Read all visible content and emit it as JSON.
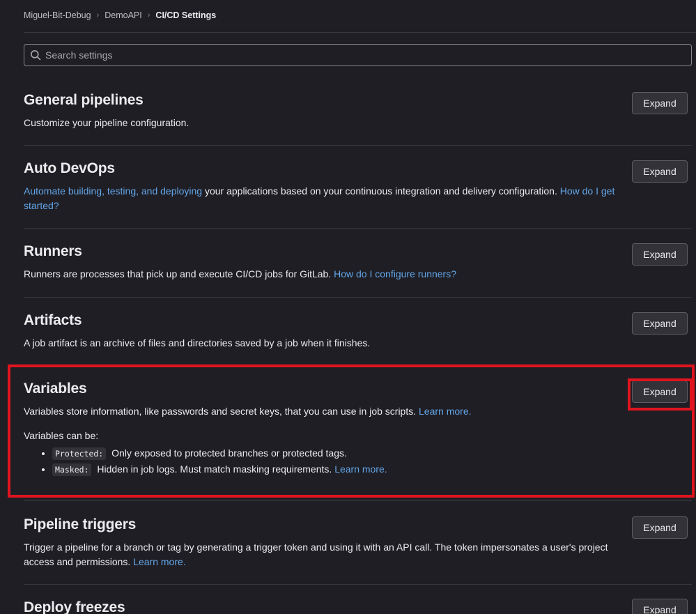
{
  "breadcrumb": {
    "items": [
      "Miguel-Bit-Debug",
      "DemoAPI",
      "CI/CD Settings"
    ],
    "separator": "›"
  },
  "search": {
    "placeholder": "Search settings",
    "value": ""
  },
  "expand_label": "Expand",
  "sections": {
    "general": {
      "title": "General pipelines",
      "desc": "Customize your pipeline configuration."
    },
    "autodevops": {
      "title": "Auto DevOps",
      "link1": "Automate building, testing, and deploying",
      "text": " your applications based on your continuous integration and delivery configuration. ",
      "link2": "How do I get started?"
    },
    "runners": {
      "title": "Runners",
      "text": "Runners are processes that pick up and execute CI/CD jobs for GitLab. ",
      "link": "How do I configure runners?"
    },
    "artifacts": {
      "title": "Artifacts",
      "desc": "A job artifact is an archive of files and directories saved by a job when it finishes."
    },
    "variables": {
      "title": "Variables",
      "text": "Variables store information, like passwords and secret keys, that you can use in job scripts. ",
      "link": "Learn more.",
      "can_be": "Variables can be:",
      "items": [
        {
          "code": "Protected:",
          "text": " Only exposed to protected branches or protected tags.",
          "link": ""
        },
        {
          "code": "Masked:",
          "text": " Hidden in job logs. Must match masking requirements. ",
          "link": "Learn more."
        }
      ]
    },
    "triggers": {
      "title": "Pipeline triggers",
      "text": "Trigger a pipeline for a branch or tag by generating a trigger token and using it with an API call. The token impersonates a user's project access and permissions. ",
      "link": "Learn more."
    },
    "freezes": {
      "title": "Deploy freezes"
    }
  },
  "colors": {
    "background": "#1f1e24",
    "link": "#63a6e9",
    "highlight": "#e0141e"
  }
}
